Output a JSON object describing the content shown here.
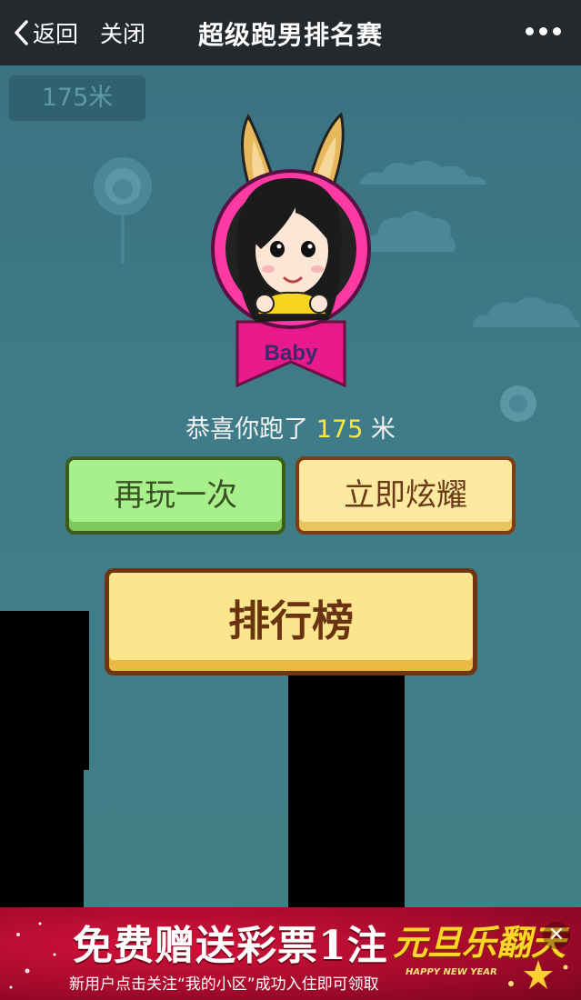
{
  "navbar": {
    "back_label": "返回",
    "close_label": "关闭",
    "title": "超级跑男排名赛"
  },
  "game": {
    "distance_display": "175米",
    "character_name": "Baby",
    "congrats_prefix": "恭喜你跑了",
    "congrats_score": "175",
    "congrats_unit": "米",
    "buttons": {
      "replay": "再玩一次",
      "show_off": "立即炫耀",
      "leaderboard": "排行榜"
    }
  },
  "ad": {
    "headline": "免费赠送彩票1注",
    "subline": "新用户点击关注“我的小区”成功入住即可领取",
    "promo_title": "元旦乐翻天",
    "promo_en": "HAPPY NEW YEAR",
    "close_symbol": "✕"
  },
  "colors": {
    "navbar_bg": "#24292e",
    "sky": "#3e7885",
    "score_highlight": "#ffe640",
    "badge_pink": "#e8198b",
    "replay_green": "#a8f08c",
    "show_yellow": "#fbe9a0",
    "ad_red": "#c0102e"
  },
  "icons": {
    "back": "chevron-left-icon",
    "more": "more-dots-icon",
    "close_ad": "close-icon"
  }
}
